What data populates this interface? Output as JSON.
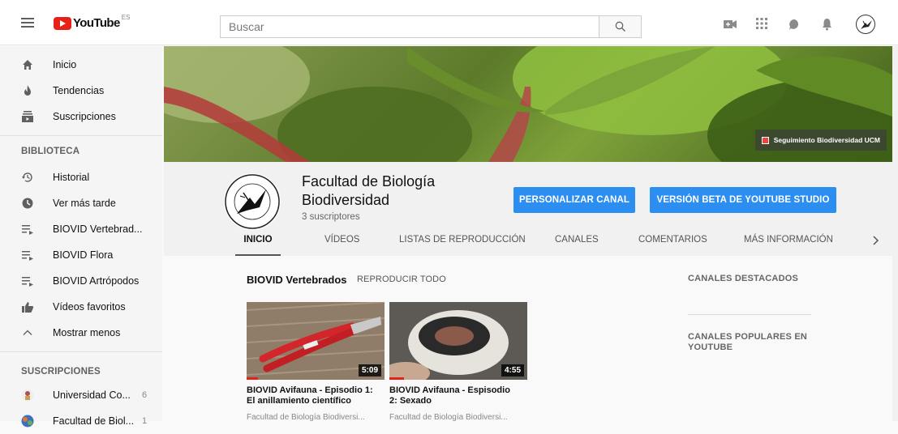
{
  "header": {
    "logo_text": "YouTube",
    "country_code": "ES",
    "search_placeholder": "Buscar"
  },
  "sidebar": {
    "main": [
      {
        "label": "Inicio",
        "icon": "home-icon"
      },
      {
        "label": "Tendencias",
        "icon": "fire-icon"
      },
      {
        "label": "Suscripciones",
        "icon": "subscriptions-icon"
      }
    ],
    "library_heading": "BIBLIOTECA",
    "library": [
      {
        "label": "Historial",
        "icon": "history-icon"
      },
      {
        "label": "Ver más tarde",
        "icon": "clock-icon"
      },
      {
        "label": "BIOVID Vertebrad...",
        "icon": "playlist-icon"
      },
      {
        "label": "BIOVID Flora",
        "icon": "playlist-icon"
      },
      {
        "label": "BIOVID Artrópodos",
        "icon": "playlist-icon"
      },
      {
        "label": "Vídeos favoritos",
        "icon": "thumbs-up-icon"
      },
      {
        "label": "Mostrar menos",
        "icon": "chevron-up-icon"
      }
    ],
    "subscriptions_heading": "SUSCRIPCIONES",
    "subscriptions": [
      {
        "label": "Universidad Co...",
        "count": "6"
      },
      {
        "label": "Facultad de Biol...",
        "count": "1"
      }
    ]
  },
  "banner": {
    "link_label": "Seguimiento Biodiversidad UCM"
  },
  "channel": {
    "name": "Facultad de Biología Biodiversidad",
    "subscribers": "3 suscriptores",
    "customize_button": "PERSONALIZAR CANAL",
    "studio_button": "VERSIÓN BETA DE YOUTUBE STUDIO",
    "tabs": [
      "INICIO",
      "VÍDEOS",
      "LISTAS DE REPRODUCCIÓN",
      "CANALES",
      "COMENTARIOS",
      "MÁS INFORMACIÓN"
    ],
    "active_tab": "INICIO"
  },
  "shelf": {
    "title": "BIOVID Vertebrados",
    "play_all": "REPRODUCIR TODO",
    "videos": [
      {
        "title": "BIOVID Avifauna - Episodio 1: El anillamiento científico",
        "channel": "Facultad de Biología Biodiversi...",
        "duration": "5:09"
      },
      {
        "title": "BIOVID Avifauna - Espisodio 2: Sexado",
        "channel": "Facultad de Biología Biodiversi...",
        "duration": "4:55"
      }
    ]
  },
  "side_panel": {
    "featured": "CANALES DESTACADOS",
    "popular": "CANALES POPULARES EN YOUTUBE"
  },
  "colors": {
    "accent_blue": "#2b8ef0",
    "youtube_red": "#e62117"
  }
}
